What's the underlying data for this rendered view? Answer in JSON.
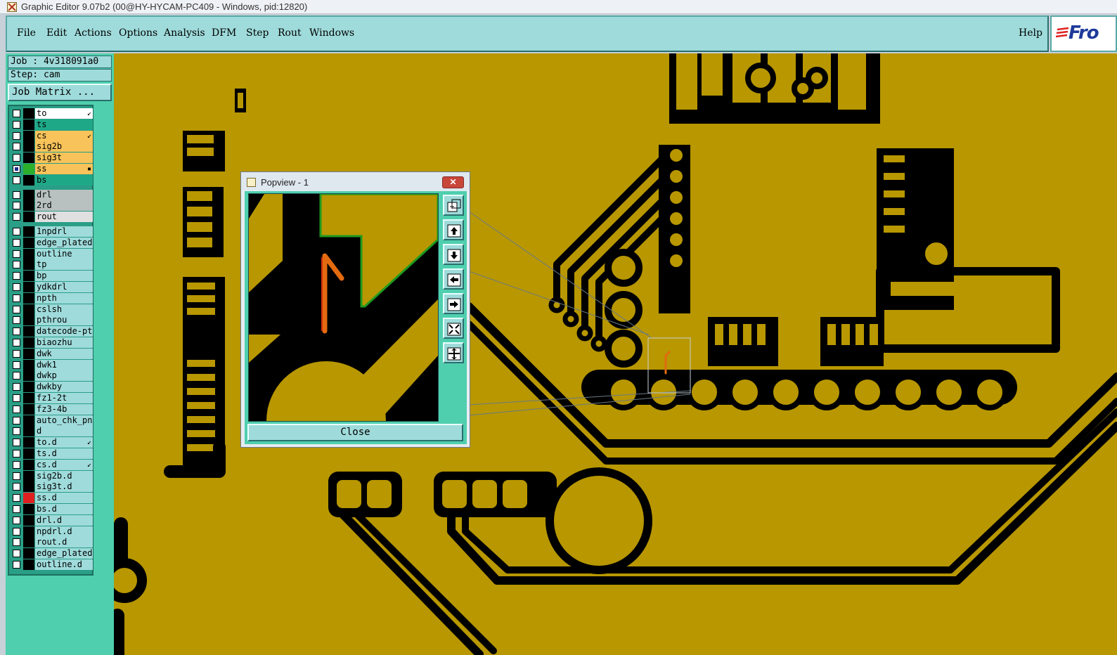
{
  "window": {
    "title": "Graphic Editor 9.07b2 (00@HY-HYCAM-PC409 - Windows, pid:12820)"
  },
  "menu": {
    "items": [
      "File",
      "Edit",
      "Actions",
      "Options",
      "Analysis",
      "DFM",
      "Step",
      "Rout",
      "Windows"
    ],
    "help": "Help"
  },
  "brand": {
    "text": "Fro"
  },
  "job": {
    "label": "Job : 4v318091a0",
    "step": "Step: cam",
    "matrix_button": "Job Matrix ..."
  },
  "layers": [
    {
      "name": "to",
      "bg": "#ffffff",
      "mark": "↙",
      "swatch": "#000000"
    },
    {
      "name": "ts",
      "bg": "#1fa887",
      "mark": "",
      "swatch": "#000000"
    },
    {
      "name": "cs",
      "bg": "#f7c35a",
      "mark": "↙",
      "swatch": "#000000"
    },
    {
      "name": "sig2b",
      "bg": "#f7c35a",
      "mark": "",
      "swatch": "#000000"
    },
    {
      "name": "sig3t",
      "bg": "#f7c35a",
      "mark": "",
      "swatch": "#000000"
    },
    {
      "name": "ss",
      "bg": "#f7c35a",
      "mark": "▪",
      "swatch": "#2bb02b",
      "checked": true
    },
    {
      "name": "bs",
      "bg": "#1fa887",
      "mark": "",
      "swatch": "#000000"
    },
    {
      "name": "drl",
      "bg": "#b8c0c0",
      "mark": "",
      "swatch": "#000000"
    },
    {
      "name": "2rd",
      "bg": "#b8c0c0",
      "mark": "",
      "swatch": "#000000"
    },
    {
      "name": "rout",
      "bg": "#e0e0e0",
      "mark": "",
      "swatch": "#000000"
    },
    {
      "name": "1npdrl",
      "bg": "#9fdbdb",
      "mark": "",
      "swatch": "#000000"
    },
    {
      "name": "edge_plated",
      "bg": "#9fdbdb",
      "mark": "",
      "swatch": "#000000"
    },
    {
      "name": "outline",
      "bg": "#9fdbdb",
      "mark": "",
      "swatch": "#000000"
    },
    {
      "name": "tp",
      "bg": "#9fdbdb",
      "mark": "",
      "swatch": "#000000"
    },
    {
      "name": "bp",
      "bg": "#9fdbdb",
      "mark": "",
      "swatch": "#000000"
    },
    {
      "name": "ydkdrl",
      "bg": "#9fdbdb",
      "mark": "",
      "swatch": "#000000"
    },
    {
      "name": "npth",
      "bg": "#9fdbdb",
      "mark": "",
      "swatch": "#000000"
    },
    {
      "name": "cslsh",
      "bg": "#9fdbdb",
      "mark": "",
      "swatch": "#000000"
    },
    {
      "name": "pthrou",
      "bg": "#9fdbdb",
      "mark": "",
      "swatch": "#000000"
    },
    {
      "name": "datecode-pte",
      "bg": "#9fdbdb",
      "mark": "",
      "swatch": "#000000"
    },
    {
      "name": "biaozhu",
      "bg": "#9fdbdb",
      "mark": "",
      "swatch": "#000000"
    },
    {
      "name": "dwk",
      "bg": "#9fdbdb",
      "mark": "",
      "swatch": "#000000"
    },
    {
      "name": "dwk1",
      "bg": "#9fdbdb",
      "mark": "",
      "swatch": "#000000"
    },
    {
      "name": "dwkp",
      "bg": "#9fdbdb",
      "mark": "",
      "swatch": "#000000"
    },
    {
      "name": "dwkby",
      "bg": "#9fdbdb",
      "mark": "",
      "swatch": "#000000"
    },
    {
      "name": "fz1-2t",
      "bg": "#9fdbdb",
      "mark": "",
      "swatch": "#000000"
    },
    {
      "name": "fz3-4b",
      "bg": "#9fdbdb",
      "mark": "",
      "swatch": "#000000"
    },
    {
      "name": "auto_chk_pnl",
      "bg": "#9fdbdb",
      "mark": "",
      "swatch": "#000000"
    },
    {
      "name": "d",
      "bg": "#9fdbdb",
      "mark": "",
      "swatch": "#000000"
    },
    {
      "name": "to.d",
      "bg": "#9fdbdb",
      "mark": "↙",
      "swatch": "#000000"
    },
    {
      "name": "ts.d",
      "bg": "#9fdbdb",
      "mark": "",
      "swatch": "#000000"
    },
    {
      "name": "cs.d",
      "bg": "#9fdbdb",
      "mark": "↙",
      "swatch": "#000000"
    },
    {
      "name": "sig2b.d",
      "bg": "#9fdbdb",
      "mark": "",
      "swatch": "#000000"
    },
    {
      "name": "sig3t.d",
      "bg": "#9fdbdb",
      "mark": "",
      "swatch": "#000000"
    },
    {
      "name": "ss.d",
      "bg": "#9fdbdb",
      "mark": "",
      "swatch": "#e02020"
    },
    {
      "name": "bs.d",
      "bg": "#9fdbdb",
      "mark": "",
      "swatch": "#000000"
    },
    {
      "name": "drl.d",
      "bg": "#9fdbdb",
      "mark": "",
      "swatch": "#000000"
    },
    {
      "name": "npdrl.d",
      "bg": "#9fdbdb",
      "mark": "",
      "swatch": "#000000"
    },
    {
      "name": "rout.d",
      "bg": "#9fdbdb",
      "mark": "",
      "swatch": "#000000"
    },
    {
      "name": "edge_plated",
      "bg": "#9fdbdb",
      "mark": "",
      "swatch": "#000000"
    },
    {
      "name": "outline.d",
      "bg": "#9fdbdb",
      "mark": "",
      "swatch": "#000000"
    }
  ],
  "popview": {
    "title": "Popview - 1",
    "close_label": "Close"
  },
  "colors": {
    "board": "#b89700",
    "copper": "#000000",
    "panel": "#9fdbdb",
    "accent": "#4fcfae"
  }
}
